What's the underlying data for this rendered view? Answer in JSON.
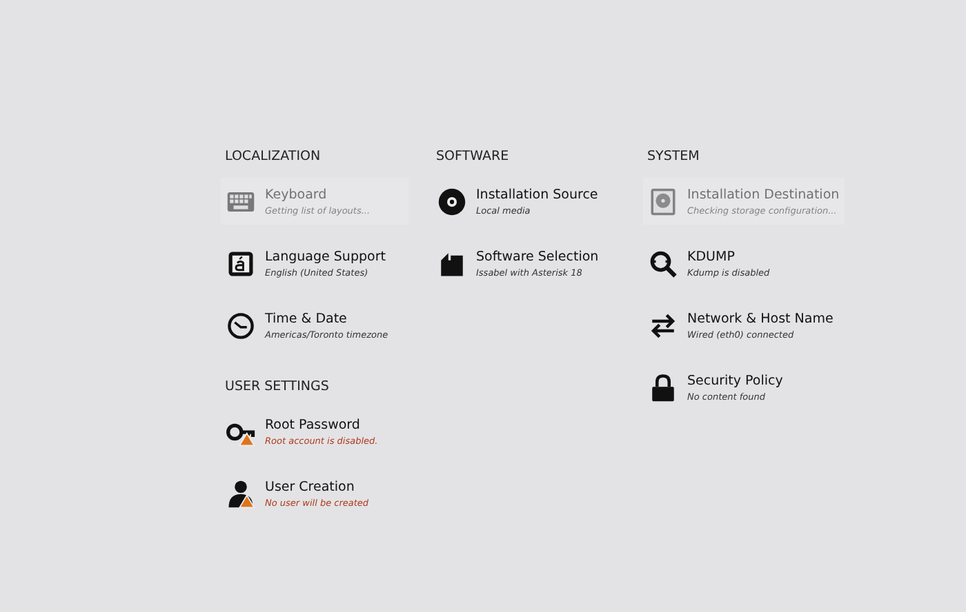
{
  "columns": [
    {
      "sections": [
        {
          "title": "LOCALIZATION",
          "items": [
            {
              "kind": "keyboard",
              "title": "Keyboard",
              "status": "Getting list of layouts...",
              "disabled": true,
              "warning": false
            },
            {
              "kind": "language",
              "title": "Language Support",
              "status": "English (United States)",
              "disabled": false,
              "warning": false
            },
            {
              "kind": "clock",
              "title": "Time & Date",
              "status": "Americas/Toronto timezone",
              "disabled": false,
              "warning": false
            }
          ]
        },
        {
          "title": "USER SETTINGS",
          "items": [
            {
              "kind": "key",
              "title": "Root Password",
              "status": "Root account is disabled.",
              "disabled": false,
              "warning": true
            },
            {
              "kind": "user",
              "title": "User Creation",
              "status": "No user will be created",
              "disabled": false,
              "warning": true
            }
          ]
        }
      ]
    },
    {
      "sections": [
        {
          "title": "SOFTWARE",
          "items": [
            {
              "kind": "disc",
              "title": "Installation Source",
              "status": "Local media",
              "disabled": false,
              "warning": false
            },
            {
              "kind": "package",
              "title": "Software Selection",
              "status": "Issabel with Asterisk 18",
              "disabled": false,
              "warning": false
            }
          ]
        }
      ]
    },
    {
      "sections": [
        {
          "title": "SYSTEM",
          "items": [
            {
              "kind": "disk",
              "title": "Installation Destination",
              "status": "Checking storage configuration...",
              "disabled": true,
              "warning": false
            },
            {
              "kind": "search",
              "title": "KDUMP",
              "status": "Kdump is disabled",
              "disabled": false,
              "warning": false
            },
            {
              "kind": "arrows",
              "title": "Network & Host Name",
              "status": "Wired (eth0) connected",
              "disabled": false,
              "warning": false
            },
            {
              "kind": "lock",
              "title": "Security Policy",
              "status": "No content found",
              "disabled": false,
              "warning": false
            }
          ]
        }
      ]
    }
  ]
}
